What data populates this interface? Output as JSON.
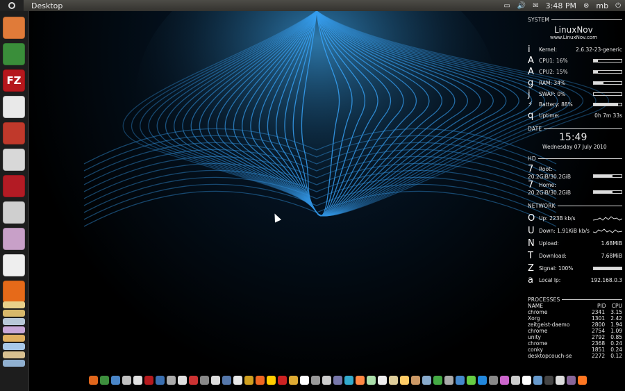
{
  "panel": {
    "window_title": "Desktop",
    "time": "3:48 PM",
    "user": "mb",
    "icons": [
      "battery-icon",
      "volume-icon",
      "mail-icon",
      "user-icon",
      "power-icon"
    ]
  },
  "launcher": {
    "items": [
      {
        "name": "files",
        "color": "#e07b39",
        "label": ""
      },
      {
        "name": "chrome",
        "color": "#3a8e3a",
        "label": ""
      },
      {
        "name": "filezilla",
        "color": "#b5171c",
        "label": "FZ"
      },
      {
        "name": "blank-app",
        "color": "#e9e9e9",
        "label": ""
      },
      {
        "name": "install",
        "color": "#c0392b",
        "label": ""
      },
      {
        "name": "text-editor",
        "color": "#d8d8d8",
        "label": ""
      },
      {
        "name": "pidgin",
        "color": "#b31b24",
        "label": ""
      },
      {
        "name": "camera",
        "color": "#cfcfcf",
        "label": ""
      },
      {
        "name": "media",
        "color": "#c8a0c8",
        "label": ""
      },
      {
        "name": "blank-app-2",
        "color": "#eeeeee",
        "label": ""
      },
      {
        "name": "firefox",
        "color": "#e66a19",
        "label": ""
      }
    ]
  },
  "conky": {
    "system_header": "SYSTEM",
    "host": "LinuxNov",
    "url": "www.LinuxNov.com",
    "kernel_label": "Kernel:",
    "kernel_value": "2.6.32-23-generic",
    "cpu1_label": "CPU1: 16%",
    "cpu1": 0.16,
    "cpu2_label": "CPU2: 15%",
    "cpu2": 0.15,
    "ram_label": "RAM: 34%",
    "ram": 0.34,
    "swap_label": "SWAP: 0%",
    "swap": 0.0,
    "battery_label": "Battery: 88%",
    "battery": 0.88,
    "uptime_label": "Uptime:",
    "uptime_value": "0h 7m 33s",
    "glyphs": {
      "kernel": "i",
      "cpu1": "A",
      "cpu2": "A",
      "ram": "g",
      "swap": "j",
      "battery": "⚡",
      "uptime": "q",
      "root": "7",
      "home": "7",
      "up": "O",
      "down": "U",
      "upload": "N",
      "download": "T",
      "signal": "Z",
      "ip": "a"
    },
    "date_header": "DATE",
    "clock": "15:49",
    "date": "Wednesday 07 July 2010",
    "hd_header": "HD",
    "root_label": "Root:",
    "root_value": "20.2GiB/30.2GiB",
    "root": 0.67,
    "home_label": "Home:",
    "home_value": "20.2GiB/30.2GiB",
    "home": 0.67,
    "network_header": "NETWORK",
    "up_label": "Up: 223B  kb/s",
    "down_label": "Down: 1.91KiB kb/s",
    "upload_label": "Upload:",
    "upload_value": "1.68MiB",
    "download_label": "Download:",
    "download_value": "7.68MiB",
    "signal_label": "Signal: 100%",
    "signal": 1.0,
    "ip_label": "Local Ip:",
    "ip_value": "192.168.0.3",
    "processes_header": "PROCESSES",
    "proc_cols": [
      "NAME",
      "PID",
      "CPU"
    ],
    "processes": [
      {
        "name": "chrome",
        "pid": "2341",
        "cpu": "3.15"
      },
      {
        "name": "Xorg",
        "pid": "1301",
        "cpu": "2.42"
      },
      {
        "name": "zeitgeist-daemo",
        "pid": "2800",
        "cpu": "1.94"
      },
      {
        "name": "chrome",
        "pid": "2754",
        "cpu": "1.09"
      },
      {
        "name": "unity",
        "pid": "2792",
        "cpu": "0.85"
      },
      {
        "name": "chrome",
        "pid": "2368",
        "cpu": "0.24"
      },
      {
        "name": "conky",
        "pid": "1851",
        "cpu": "0.24"
      },
      {
        "name": "desktopcouch-se",
        "pid": "2272",
        "cpu": "0.12"
      }
    ]
  },
  "dock": {
    "colors": [
      "#e0661c",
      "#3d8f3d",
      "#4a86c8",
      "#c0c0c0",
      "#e0e0e0",
      "#b51a1e",
      "#3a6fb0",
      "#aaaaaa",
      "#e0e0e0",
      "#cc3333",
      "#888888",
      "#dddddd",
      "#5577aa",
      "#e8e8e8",
      "#d0a020",
      "#ee6622",
      "#ffcc00",
      "#cc2222",
      "#ddaa33",
      "#ffffff",
      "#999999",
      "#cccccc",
      "#7777aa",
      "#33aacc",
      "#ff8844",
      "#aaddaa",
      "#eeeeee",
      "#ddcc99",
      "#ffcc66",
      "#cc9966",
      "#88aacc",
      "#44aa44",
      "#aaaaaa",
      "#4488cc",
      "#66cc44",
      "#2288dd",
      "#888888",
      "#cc66cc",
      "#cccccc",
      "#ffffff",
      "#6699cc",
      "#444444",
      "#dddddd",
      "#886699",
      "#ff7722"
    ]
  }
}
